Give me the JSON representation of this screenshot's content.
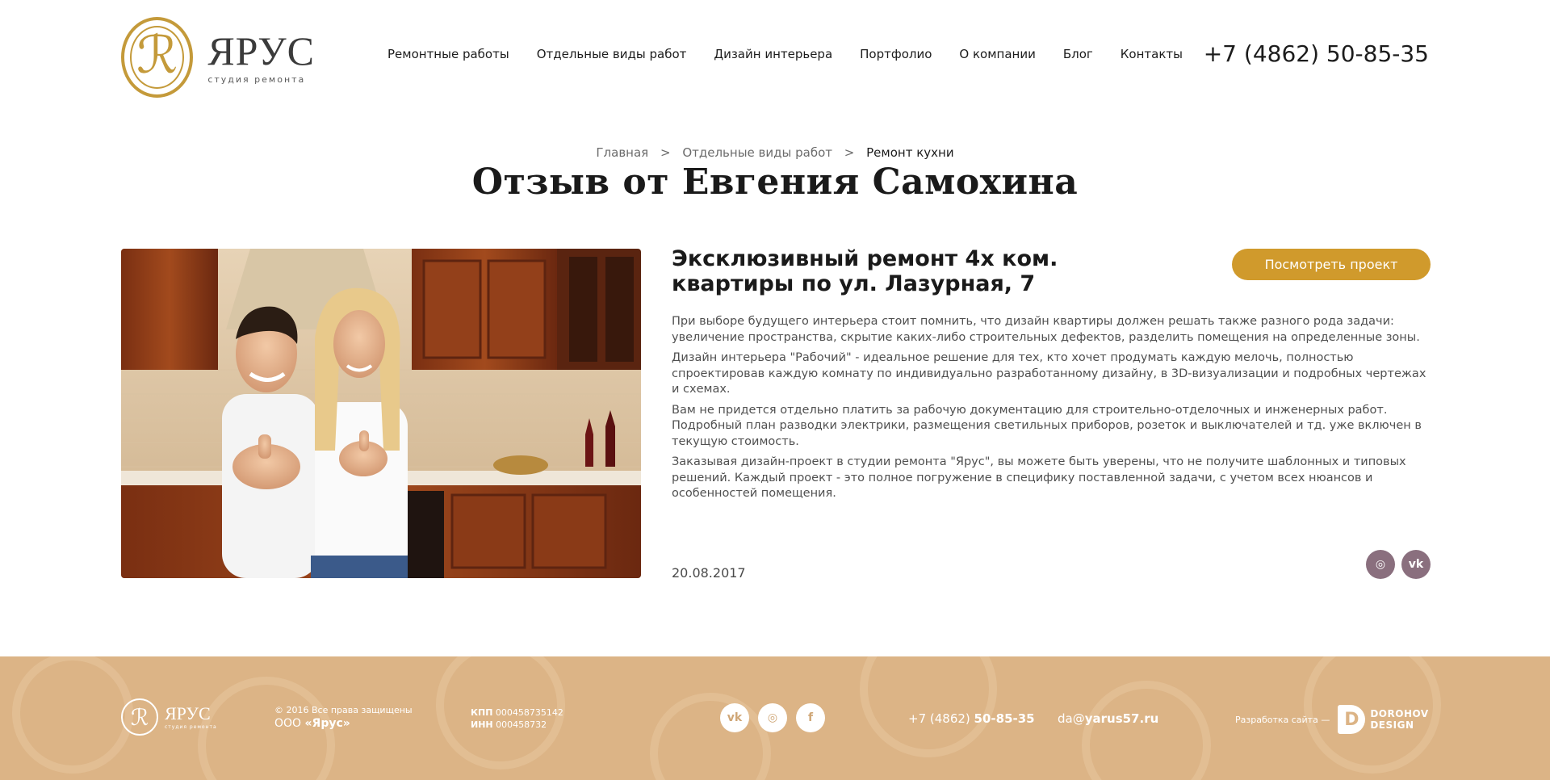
{
  "header": {
    "logo": {
      "mark": "ℛ",
      "word": "ЯРУС",
      "sub": "студия ремонта"
    },
    "nav": [
      {
        "label": "Ремонтные работы"
      },
      {
        "label": "Отдельные виды работ"
      },
      {
        "label": "Дизайн интерьера"
      },
      {
        "label": "Портфолио"
      },
      {
        "label": "О компании"
      },
      {
        "label": "Блог"
      },
      {
        "label": "Контакты"
      }
    ],
    "phone": "+7 (4862) 50-85-35"
  },
  "breadcrumb": {
    "items": [
      "Главная",
      "Отдельные виды работ"
    ],
    "separator": ">",
    "current": "Ремонт кухни"
  },
  "page": {
    "title": "Отзыв от Евгения Самохина"
  },
  "article": {
    "title_line1": "Эксклюзивный ремонт 4х ком.",
    "title_line2": "квартиры по ул. Лазурная, 7",
    "button_label": "Посмотреть проект",
    "paragraphs": [
      "При выборе будущего интерьера стоит помнить, что дизайн квартиры должен решать также разного рода задачи: увеличение пространства, скрытие каких-либо строительных дефектов, разделить помещения на определенные зоны.",
      "Дизайн интерьера \"Рабочий\" - идеальное решение для тех, кто хочет продумать каждую мелочь, полностью спроектировав каждую комнату по индивидуально разработанному дизайну, в 3D-визуализации и подробных чертежах и схемах.",
      "Вам не придется отдельно платить за рабочую документацию для строительно-отделочных и инженерных работ. Подробный план разводки электрики, размещения светильных приборов, розеток и выключателей и тд. уже включен в текущую стоимость.",
      "Заказывая дизайн-проект в студии ремонта \"Ярус\", вы можете быть уверены, что не получите шаблонных и типовых решений. Каждый проект - это полное погружение в специфику поставленной задачи, с учетом всех нюансов и особенностей помещения."
    ],
    "date": "20.08.2017",
    "share": [
      {
        "icon": "instagram-icon",
        "glyph": "◎"
      },
      {
        "icon": "vk-icon",
        "glyph": "vk"
      }
    ]
  },
  "footer": {
    "logo": {
      "mark": "ℛ",
      "word": "ЯРУС",
      "sub": "студия ремонта"
    },
    "copyright": "© 2016 Все права защищены",
    "org_prefix": "ООО",
    "org_name": "«Ярус»",
    "kpp_label": "КПП",
    "kpp_value": "000458735142",
    "inn_label": "ИНН",
    "inn_value": "000458732",
    "social": [
      {
        "icon": "vk-icon",
        "glyph": "vk"
      },
      {
        "icon": "instagram-icon",
        "glyph": "◎"
      },
      {
        "icon": "facebook-icon",
        "glyph": "f"
      }
    ],
    "phone_prefix": "+7 (4862)",
    "phone_number": "50-85-35",
    "email_user": "da@",
    "email_domain": "yarus57.ru",
    "dev_label": "Разработка сайта —",
    "dev_mark": "D",
    "dev_name_line1": "DOROHOV",
    "dev_name_line2": "DESIGN"
  },
  "colors": {
    "accent": "#d09a2c",
    "logo_gold": "#c49a3a",
    "footer_bg": "#dcb486",
    "share_bg": "#8a6f7e"
  }
}
